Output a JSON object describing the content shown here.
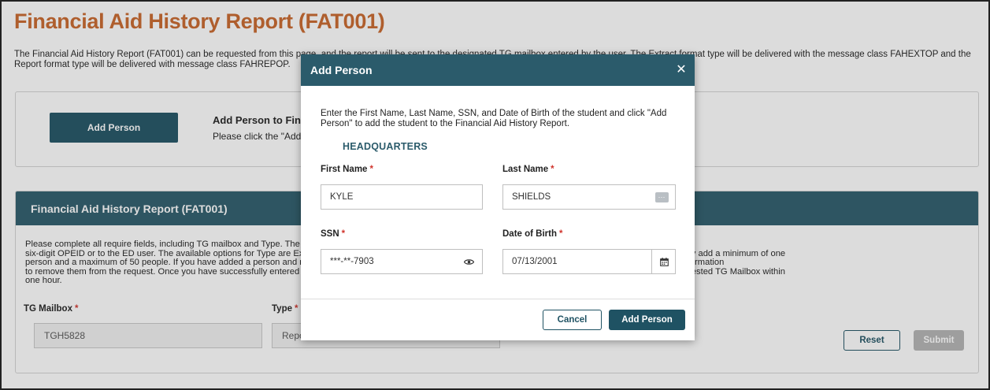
{
  "page": {
    "title": "Financial Aid History Report (FAT001)",
    "intro": "The Financial Aid History Report (FAT001) can be requested from this page, and the report will be sent to the designated TG mailbox entered by the user. The Extract format type will be delivered with the message class FAHEXTOP and the Report format type will be delivered with message class FAHREPOP."
  },
  "add_section": {
    "button_label": "Add Person",
    "title": "Add Person to Financial Aid History Report",
    "description": "Please click the \"Add Person\" button to add a student to the report."
  },
  "report_section": {
    "header": "Financial Aid History Report (FAT001)",
    "text_line1": "Please complete all require fields, including TG mailbox and Type. The TG mailbox you enter must be valid in the NSLDS system and associated to the school user's",
    "text_line2": "six-digit OPEID or to the ED user. The available options for Type are Extract and Report. Then add the person or people you are requesting financial aid history for. You may add a minimum of one",
    "text_line3": "person and a maximum of 50 people. If you have added a person and no longer wish to request financial aid history for that person, click the 'Delete' button next to their information",
    "text_line4": "to remove them from the request. Once you have successfully entered all information, click 'Submit'. The Financial Aid History (FAT001) Report will be delivered to the requested TG Mailbox within",
    "text_line5": "one hour.",
    "tg_mailbox_label": "TG Mailbox",
    "tg_mailbox_value": "TGH5828",
    "type_label": "Type",
    "type_value": "Report",
    "required_mark": "*",
    "reset_label": "Reset",
    "submit_label": "Submit"
  },
  "modal": {
    "title": "Add Person",
    "close_glyph": "✕",
    "instructions": "Enter the First Name, Last Name, SSN, and Date of Birth of the student and click \"Add Person\" to add the student to the Financial Aid History Report.",
    "organization": "HEADQUARTERS",
    "first_name_label": "First Name",
    "first_name_value": "KYLE",
    "last_name_label": "Last Name",
    "last_name_value": "SHIELDS",
    "ssn_label": "SSN",
    "ssn_value": "***-**-7903",
    "dob_label": "Date of Birth",
    "dob_value": "07/13/2001",
    "required_mark": "*",
    "cancel_label": "Cancel",
    "add_label": "Add Person"
  },
  "icons": {
    "dots": "···",
    "eye": "eye-icon",
    "calendar": "calendar-icon"
  },
  "colors": {
    "title_orange": "#c8662a",
    "header_teal": "#2b5b6b",
    "button_teal": "#1f5263",
    "required_red": "#d0342c"
  }
}
